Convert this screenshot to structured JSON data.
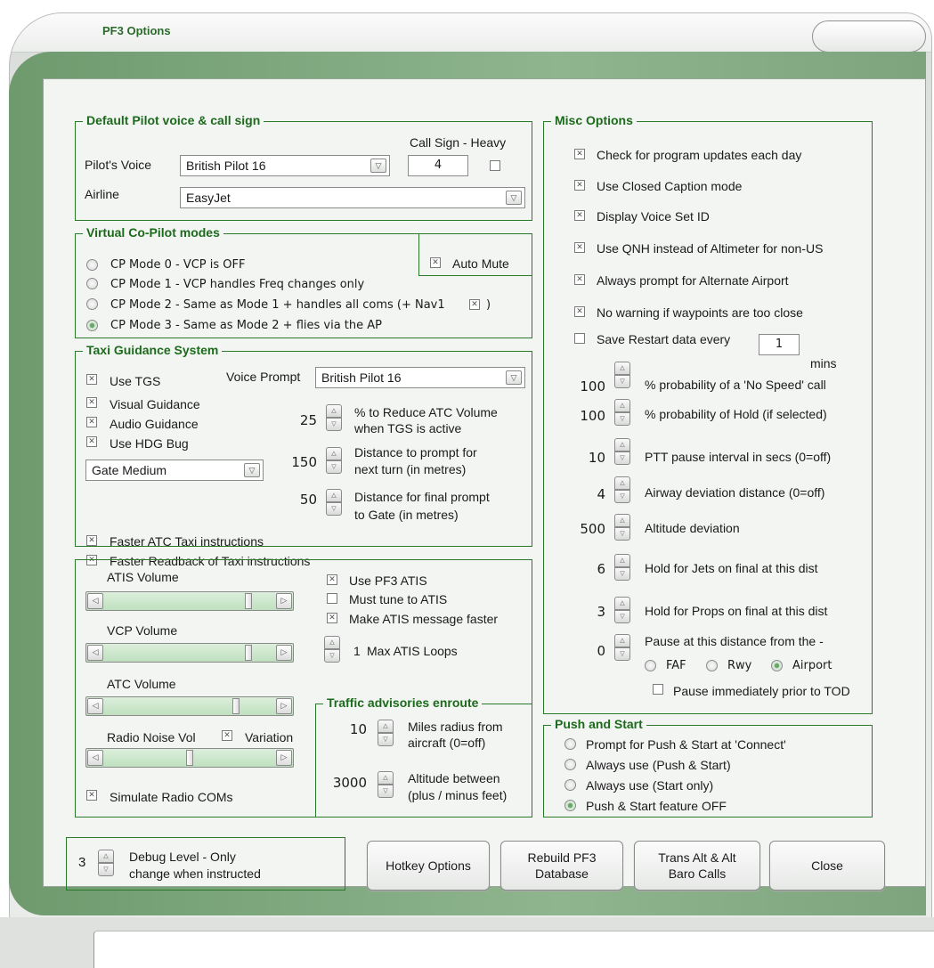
{
  "window": {
    "title": "PF3 Options"
  },
  "pilot": {
    "legend": "Default Pilot voice & call sign",
    "voice_label": "Pilot's Voice",
    "voice_value": "British Pilot 16",
    "callsign_heavy_label": "Call Sign - Heavy",
    "callsign_value": "4",
    "airline_label": "Airline",
    "airline_value": "EasyJet"
  },
  "vcp": {
    "legend": "Virtual Co-Pilot modes",
    "auto_mute": "Auto Mute",
    "mode0": "CP Mode 0 - VCP is OFF",
    "mode1": "CP Mode 1 - VCP handles Freq changes only",
    "mode2": "CP Mode 2 - Same as Mode 1 + handles all coms (+ Nav1",
    "mode2_close": ")",
    "mode3": "CP Mode 3 - Same as Mode 2 + flies via the AP",
    "selected": 3
  },
  "tgs": {
    "legend": "Taxi Guidance System",
    "use_tgs": "Use TGS",
    "voice_prompt_label": "Voice Prompt",
    "voice_prompt_value": "British Pilot 16",
    "visual": "Visual Guidance",
    "audio": "Audio Guidance",
    "hdg": "Use HDG Bug",
    "gate_value": "Gate Medium",
    "reduce_val": "25",
    "reduce_label1": "% to Reduce ATC Volume",
    "reduce_label2": "when TGS is active",
    "turn_val": "150",
    "turn_label1": "Distance to prompt for",
    "turn_label2": "next turn (in metres)",
    "final_val": "50",
    "final_label1": "Distance for final prompt",
    "final_label2": "to Gate (in metres)",
    "faster_atc": "Faster ATC Taxi instructions",
    "faster_readback": "Faster Readback of Taxi instructions"
  },
  "audio": {
    "atis_volume": "ATIS Volume",
    "atis_level": 0.86,
    "vcp_volume": "VCP Volume",
    "vcp_level": 0.86,
    "atc_volume": "ATC Volume",
    "atc_level": 0.78,
    "noise_vol": "Radio Noise Vol",
    "noise_level": 0.5,
    "variation": "Variation",
    "simulate": "Simulate Radio COMs",
    "use_pf3_atis": "Use PF3 ATIS",
    "must_tune": "Must tune to ATIS",
    "atis_faster": "Make ATIS message faster",
    "max_loops_val": "1",
    "max_loops_label": "Max ATIS Loops"
  },
  "traffic": {
    "legend": "Traffic advisories enroute",
    "miles_val": "10",
    "miles_label1": "Miles radius from",
    "miles_label2": "aircraft (0=off)",
    "alt_val": "3000",
    "alt_label1": "Altitude between",
    "alt_label2": "(plus / minus feet)"
  },
  "misc": {
    "legend": "Misc Options",
    "updates": "Check for program updates each day",
    "closed_caption": "Use Closed Caption mode",
    "voice_set": "Display Voice Set ID",
    "qnh": "Use QNH instead of Altimeter for non-US",
    "alternate": "Always prompt for Alternate Airport",
    "no_warning": "No warning if waypoints are too close",
    "save_restart": "Save Restart data every",
    "save_val": "1",
    "mins": "mins",
    "nospeed_val": "100",
    "nospeed_label": "% probability of a 'No Speed' call",
    "hold_val": "100",
    "hold_label": "% probability of Hold (if selected)",
    "ptt_val": "10",
    "ptt_label": "PTT pause interval in secs (0=off)",
    "airway_val": "4",
    "airway_label": "Airway deviation distance (0=off)",
    "altdev_val": "500",
    "altdev_label": "Altitude deviation",
    "jets_val": "6",
    "jets_label": "Hold for Jets on final at this dist",
    "props_val": "3",
    "props_label": "Hold for Props on final at this dist",
    "pause_val": "0",
    "pause_label": "Pause at this distance from the -",
    "faf": "FAF",
    "rwy": "Rwy",
    "airport": "Airport",
    "pause_tod": "Pause immediately prior to TOD"
  },
  "push": {
    "legend": "Push and Start",
    "opt1": "Prompt for Push & Start at 'Connect'",
    "opt2": "Always use (Push & Start)",
    "opt3": "Always use (Start only)",
    "opt4": "Push & Start feature OFF"
  },
  "debug": {
    "val": "3",
    "label1": "Debug Level - Only",
    "label2": "change when instructed"
  },
  "buttons": {
    "hotkey": "Hotkey Options",
    "rebuild": "Rebuild PF3\nDatabase",
    "trans": "Trans Alt & Alt\nBaro Calls",
    "close": "Close"
  }
}
